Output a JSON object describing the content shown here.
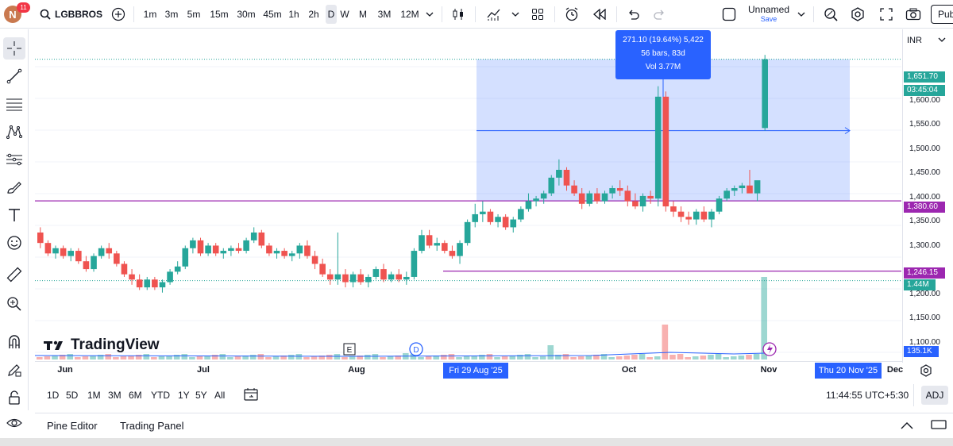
{
  "header": {
    "notification_count": "11",
    "avatar_letter": "N",
    "symbol": "LGBBROS",
    "intervals": [
      "1m",
      "3m",
      "5m",
      "15m",
      "30m",
      "45m",
      "1h",
      "2h",
      "D",
      "W",
      "M",
      "3M",
      "12M"
    ],
    "active_interval": "D",
    "layout_name": "Unnamed",
    "save_label": "Save",
    "publish_label": "Pub"
  },
  "price_axis": {
    "currency": "INR",
    "ticks": [
      "1,600.00",
      "1,550.00",
      "1,500.00",
      "1,450.00",
      "1,400.00",
      "1,350.00",
      "1,300.00",
      "1,200.00",
      "1,150.00",
      "1,100.00"
    ],
    "last_price": "1,651.70",
    "countdown": "03:45:04",
    "hline_upper_price": "1,380.60",
    "hline_lower_price": "1,246.15",
    "volume_label": "1.44M",
    "vol_ma_label": "135.1K"
  },
  "measure": {
    "line1": "271.10 (19.64%) 5,422",
    "line2": "56 bars, 83d",
    "line3": "Vol 3.77M"
  },
  "time_axis": {
    "labels": [
      "Jun",
      "Jul",
      "Aug",
      "Oct",
      "Nov",
      "Dec"
    ],
    "start_date": "Fri 29 Aug '25",
    "end_date": "Thu 20 Nov '25"
  },
  "markers": {
    "earnings": "E",
    "dividend": "D"
  },
  "logo_text": "TradingView",
  "bottom": {
    "ranges": [
      "1D",
      "5D",
      "1M",
      "3M",
      "6M",
      "YTD",
      "1Y",
      "5Y",
      "All"
    ],
    "clock": "11:44:55 UTC+5:30",
    "adj": "ADJ"
  },
  "panel": {
    "pine_editor": "Pine Editor",
    "trading_panel": "Trading Panel"
  },
  "colors": {
    "up": "#26a69a",
    "down": "#ef5350",
    "measure_fill": "#2962ff",
    "hline": "#9c27b0"
  },
  "chart_data": {
    "type": "candlestick",
    "title": "",
    "series": [
      {
        "name": "LGBBROS",
        "ohlc_approx": [
          [
            1320,
            1330,
            1290,
            1300
          ],
          [
            1300,
            1305,
            1275,
            1280
          ],
          [
            1280,
            1295,
            1270,
            1290
          ],
          [
            1290,
            1295,
            1270,
            1275
          ],
          [
            1275,
            1290,
            1265,
            1285
          ],
          [
            1285,
            1290,
            1260,
            1265
          ],
          [
            1265,
            1275,
            1245,
            1250
          ],
          [
            1250,
            1280,
            1245,
            1275
          ],
          [
            1275,
            1295,
            1270,
            1290
          ],
          [
            1290,
            1300,
            1270,
            1280
          ],
          [
            1280,
            1285,
            1255,
            1260
          ],
          [
            1260,
            1265,
            1235,
            1240
          ],
          [
            1240,
            1250,
            1220,
            1230
          ],
          [
            1230,
            1240,
            1210,
            1215
          ],
          [
            1215,
            1235,
            1210,
            1230
          ],
          [
            1230,
            1235,
            1210,
            1215
          ],
          [
            1215,
            1230,
            1205,
            1225
          ],
          [
            1225,
            1250,
            1220,
            1245
          ],
          [
            1245,
            1265,
            1240,
            1255
          ],
          [
            1255,
            1295,
            1250,
            1290
          ],
          [
            1290,
            1310,
            1280,
            1305
          ],
          [
            1305,
            1310,
            1275,
            1280
          ],
          [
            1280,
            1300,
            1275,
            1295
          ],
          [
            1295,
            1300,
            1275,
            1280
          ],
          [
            1280,
            1290,
            1270,
            1285
          ],
          [
            1285,
            1295,
            1275,
            1290
          ],
          [
            1290,
            1300,
            1280,
            1285
          ],
          [
            1285,
            1310,
            1280,
            1305
          ],
          [
            1305,
            1330,
            1300,
            1320
          ],
          [
            1320,
            1325,
            1290,
            1295
          ],
          [
            1295,
            1300,
            1275,
            1280
          ],
          [
            1280,
            1290,
            1270,
            1285
          ],
          [
            1285,
            1290,
            1270,
            1275
          ],
          [
            1275,
            1285,
            1265,
            1280
          ],
          [
            1280,
            1300,
            1270,
            1295
          ],
          [
            1295,
            1305,
            1270,
            1275
          ],
          [
            1275,
            1285,
            1250,
            1260
          ],
          [
            1260,
            1270,
            1235,
            1240
          ],
          [
            1240,
            1250,
            1220,
            1230
          ],
          [
            1230,
            1320,
            1220,
            1240
          ],
          [
            1240,
            1250,
            1215,
            1225
          ],
          [
            1225,
            1245,
            1215,
            1240
          ],
          [
            1240,
            1250,
            1220,
            1225
          ],
          [
            1225,
            1240,
            1215,
            1235
          ],
          [
            1235,
            1255,
            1230,
            1250
          ],
          [
            1250,
            1260,
            1225,
            1230
          ],
          [
            1230,
            1245,
            1225,
            1240
          ],
          [
            1240,
            1250,
            1225,
            1230
          ],
          [
            1230,
            1245,
            1220,
            1235
          ],
          [
            1235,
            1290,
            1230,
            1285
          ],
          [
            1285,
            1325,
            1280,
            1315
          ],
          [
            1315,
            1325,
            1290,
            1295
          ],
          [
            1295,
            1310,
            1285,
            1300
          ],
          [
            1300,
            1305,
            1280,
            1285
          ],
          [
            1285,
            1295,
            1270,
            1275
          ],
          [
            1275,
            1305,
            1260,
            1300
          ],
          [
            1300,
            1345,
            1295,
            1340
          ],
          [
            1340,
            1375,
            1330,
            1355
          ],
          [
            1355,
            1380,
            1340,
            1360
          ],
          [
            1360,
            1365,
            1335,
            1340
          ],
          [
            1340,
            1355,
            1330,
            1350
          ],
          [
            1350,
            1355,
            1325,
            1330
          ],
          [
            1330,
            1350,
            1320,
            1345
          ],
          [
            1345,
            1370,
            1340,
            1365
          ],
          [
            1365,
            1395,
            1360,
            1380
          ],
          [
            1380,
            1390,
            1370,
            1385
          ],
          [
            1385,
            1400,
            1375,
            1395
          ],
          [
            1395,
            1430,
            1390,
            1425
          ],
          [
            1425,
            1460,
            1410,
            1440
          ],
          [
            1440,
            1445,
            1400,
            1410
          ],
          [
            1410,
            1420,
            1390,
            1395
          ],
          [
            1395,
            1405,
            1365,
            1375
          ],
          [
            1375,
            1400,
            1370,
            1395
          ],
          [
            1395,
            1405,
            1375,
            1380
          ],
          [
            1380,
            1400,
            1375,
            1395
          ],
          [
            1395,
            1410,
            1385,
            1405
          ],
          [
            1405,
            1420,
            1390,
            1400
          ],
          [
            1400,
            1410,
            1370,
            1380
          ],
          [
            1380,
            1395,
            1365,
            1370
          ],
          [
            1370,
            1395,
            1360,
            1390
          ],
          [
            1390,
            1400,
            1375,
            1385
          ],
          [
            1385,
            1600,
            1370,
            1580
          ],
          [
            1580,
            1590,
            1360,
            1370
          ],
          [
            1370,
            1380,
            1350,
            1360
          ],
          [
            1360,
            1370,
            1340,
            1350
          ],
          [
            1350,
            1360,
            1335,
            1345
          ],
          [
            1345,
            1365,
            1335,
            1360
          ],
          [
            1360,
            1370,
            1340,
            1345
          ],
          [
            1345,
            1365,
            1330,
            1360
          ],
          [
            1360,
            1390,
            1355,
            1385
          ],
          [
            1385,
            1405,
            1380,
            1400
          ],
          [
            1400,
            1410,
            1390,
            1405
          ],
          [
            1405,
            1415,
            1395,
            1410
          ],
          [
            1410,
            1440,
            1400,
            1395
          ],
          [
            1395,
            1410,
            1380,
            1420
          ],
          [
            1520,
            1660,
            1515,
            1651.7
          ]
        ]
      }
    ],
    "ylim": [
      1080,
      1680
    ],
    "x_labels": [
      "Jun",
      "Jul",
      "Aug",
      "Oct",
      "Nov",
      "Dec"
    ],
    "measure_range": {
      "from": 1380.6,
      "to": 1651.7,
      "change": "271.10 (19.64%)"
    }
  }
}
